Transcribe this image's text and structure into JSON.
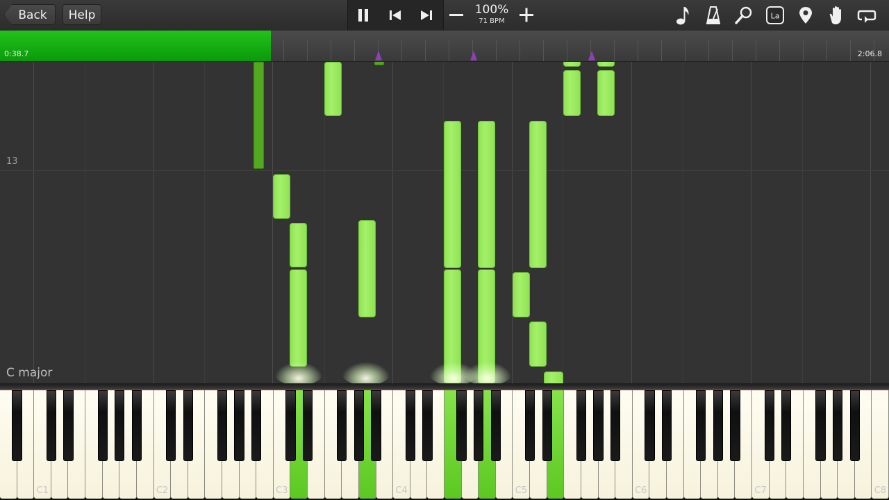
{
  "toolbar": {
    "back_label": "Back",
    "help_label": "Help",
    "speed_percent": "100%",
    "tempo": "71 BPM",
    "transport_icons": [
      "pause-icon",
      "skip-back-icon",
      "skip-forward-icon"
    ],
    "right_icons": [
      "note-icon",
      "metronome-icon",
      "magnifier-icon",
      "note-names-icon",
      "location-pin-icon",
      "hand-icon",
      "loop-icon"
    ],
    "note_names_label": "La"
  },
  "timeline": {
    "current_time": "0:38.7",
    "total_time": "2:06.8",
    "progress_fraction": 0.305,
    "accent_color": "#1bb815",
    "marker_color": "#8e3fb6"
  },
  "roll": {
    "measure_number": "13",
    "key_signature": "C major",
    "note_color": "#9ff064"
  },
  "keyboard": {
    "octave_labels": [
      "C1",
      "C2",
      "C3",
      "C4",
      "C5",
      "C6",
      "C7",
      "C8"
    ],
    "pressed_color": "#7ad83f"
  }
}
